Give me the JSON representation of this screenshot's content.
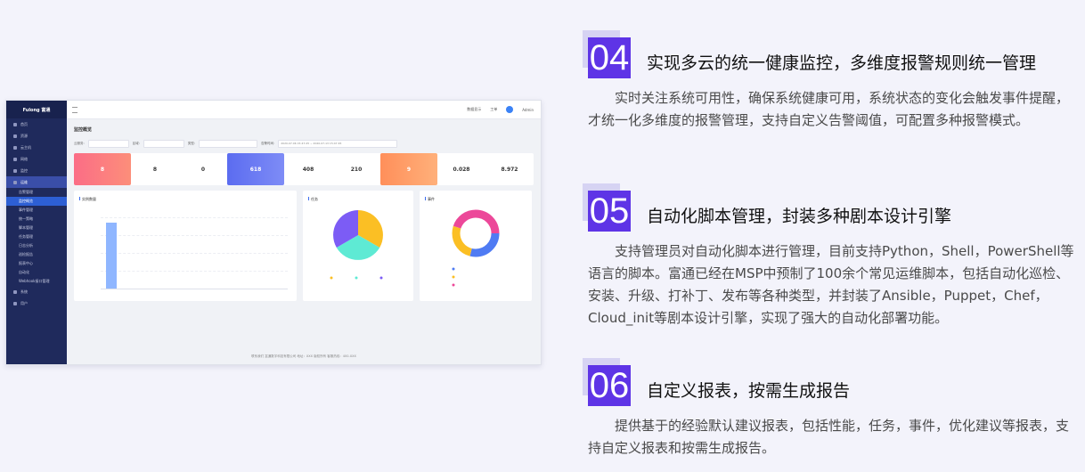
{
  "dashboard": {
    "logo": "Fulong 富通",
    "topbar": {
      "items": [
        "数据显示",
        "工单",
        "Admin"
      ]
    },
    "sidebar": {
      "items": [
        "首页",
        "资源",
        "云主机",
        "网络",
        "监控",
        "运维",
        "告警管理",
        "监控概览",
        "事件管理",
        "统一策略",
        "脚本管理",
        "任务管理",
        "日志分析",
        "巡检报告",
        "报表中心",
        "自动化",
        "Webhook接口管理",
        "系统",
        "用户"
      ]
    },
    "page_title": "监控概览",
    "filters": {
      "label_project": "云服务:",
      "label_region": "区域:",
      "label_type": "类型:",
      "label_time": "告警时间:",
      "value_time": "2020-07-06  15:47:45  ~  2020-07-13  15:47:45"
    },
    "stats": [
      "8",
      "8",
      "0",
      "618",
      "408",
      "210",
      "9",
      "0.028",
      "8.972"
    ],
    "panels": {
      "chart1": "实例数量",
      "chart2": "任务",
      "chart3": "事件"
    },
    "footer": "联系我们 富通数字科技有限公司 地址：XXX 版权所有 客服热线：400-XXX"
  },
  "features": [
    {
      "number": "04",
      "title": "实现多云的统一健康监控，多维度报警规则统一管理",
      "body": "实时关注系统可用性，确保系统健康可用，系统状态的变化会触发事件提醒，才统一化多维度的报警管理，支持自定义告警阈值，可配置多种报警模式。"
    },
    {
      "number": "05",
      "title": "自动化脚本管理，封装多种剧本设计引擎",
      "body": "支持管理员对自动化脚本进行管理，目前支持Python，Shell，PowerShell等语言的脚本。富通已经在MSP中预制了100余个常见运维脚本，包括自动化巡检、安装、升级、打补丁、发布等各种类型，并封装了Ansible，Puppet，Chef，Cloud_init等剧本设计引擎，实现了强大的自动化部署功能。"
    },
    {
      "number": "06",
      "title": "自定义报表，按需生成报告",
      "body": "提供基于的经验默认建议报表，包括性能，任务，事件，优化建议等报表，支持自定义报表和按需生成报告。"
    }
  ],
  "colors": {
    "accent": "#5e34e6",
    "accent_light": "#d6d3f3",
    "sidebar": "#1f2a5c"
  }
}
